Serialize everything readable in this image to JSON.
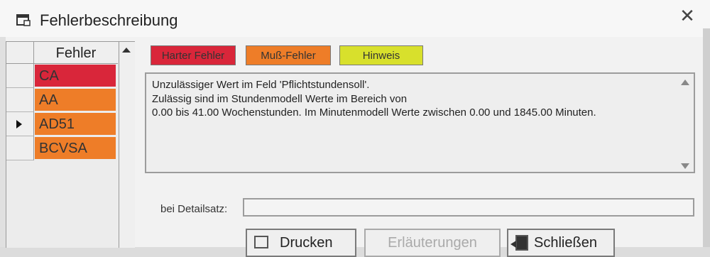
{
  "window": {
    "title": "Fehlerbeschreibung"
  },
  "grid": {
    "header": "Fehler",
    "rows": [
      {
        "code": "CA",
        "severity": "harter-fehler",
        "color": "#d9263a",
        "selected": false
      },
      {
        "code": "AA",
        "severity": "muss-fehler",
        "color": "#ee7d28",
        "selected": false
      },
      {
        "code": "AD51",
        "severity": "muss-fehler",
        "color": "#ee7d28",
        "selected": true
      },
      {
        "code": "BCVSA",
        "severity": "muss-fehler",
        "color": "#ee7d28",
        "selected": false
      }
    ]
  },
  "legend": {
    "hard": {
      "label": "Harter Fehler",
      "color": "#d9263a"
    },
    "must": {
      "label": "Muß-Fehler",
      "color": "#ee7d28"
    },
    "hint": {
      "label": "Hinweis",
      "color": "#d8e02c"
    }
  },
  "description": {
    "lines": [
      "Unzulässiger Wert im Feld 'Pflichtstundensoll'.",
      "Zulässig sind im Stundenmodell Werte im Bereich von",
      "0.00 bis 41.00 Wochenstunden. Im Minutenmodell Werte zwischen 0.00 und 1845.00 Minuten."
    ]
  },
  "detail": {
    "label": "bei Detailsatz:",
    "value": ""
  },
  "buttons": {
    "print": "Drucken",
    "explanations": "Erläuterungen",
    "close": "Schließen"
  },
  "icons": {
    "title": "dialog-icon",
    "close": "close-icon",
    "print": "printer-icon",
    "exit": "exit-door-icon"
  }
}
